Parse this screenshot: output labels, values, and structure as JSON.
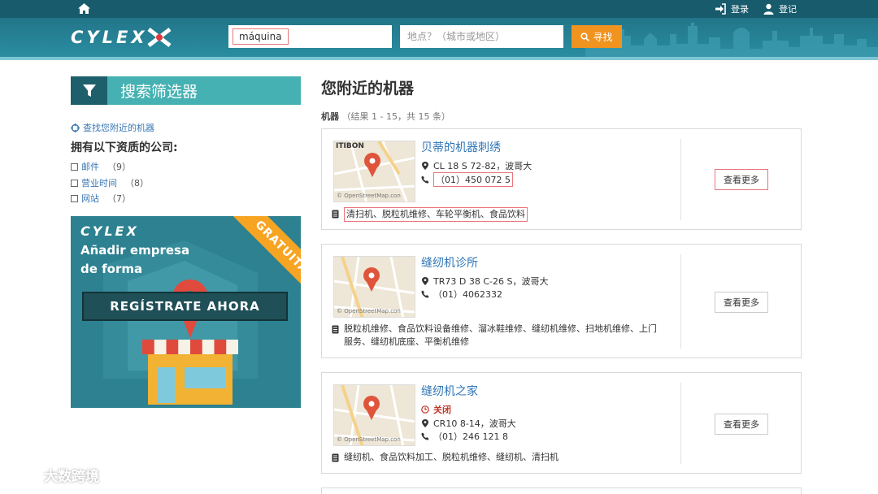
{
  "header": {
    "login_label": "登录",
    "register_label": "登记",
    "search_value": "máquina",
    "location_placeholder": "地点？（城市或地区）",
    "search_button": "寻找",
    "logo_text": "CYLEX"
  },
  "sidebar": {
    "filter_title": "搜索筛选器",
    "near_link": "查找您附近的机器",
    "quals_title": "拥有以下资质的公司:",
    "quals": [
      {
        "label": "邮件",
        "count": "（9）"
      },
      {
        "label": "营业时间",
        "count": "（8）"
      },
      {
        "label": "网站",
        "count": "（7）"
      }
    ],
    "promo": {
      "logo": "CYLEX",
      "line1": "Añadir empresa",
      "line2": "de forma",
      "ribbon": "GRATUITA!",
      "cta": "REGÍSTRATE AHORA"
    }
  },
  "main": {
    "title": "您附近的机器",
    "results_label": "机器",
    "results_detail": "（结果 1 - 15，共 15 条）",
    "listings": [
      {
        "name": "贝蒂的机器刺绣",
        "status": "",
        "address": "CL 18 S 72-82，波哥大",
        "phone": "（01）450 072 5",
        "tags": "清扫机、脱粒机维修、车轮平衡机、食品饮料",
        "map_label": "ITIBON",
        "more": "查看更多"
      },
      {
        "name": "缝纫机诊所",
        "status": "",
        "address": "TR73 D 38 C-26 S，波哥大",
        "phone": "（01）4062332",
        "tags_line1": "脱粒机维修、食品饮料设备维修、溜冰鞋维修、缝纫机维修、扫地机维修、上门",
        "tags_line2": "服务、缝纫机底座、平衡机维修",
        "more": "查看更多"
      },
      {
        "name": "缝纫机之家",
        "status": "关闭",
        "address": "CR10 8-14，波哥大",
        "phone": "（01）246 121 8",
        "tags": "缝纫机、食品饮料加工、脱粒机维修、缝纫机、清扫机",
        "more": "查看更多"
      }
    ],
    "map_credit": "© OpenStreetMap.con"
  },
  "watermark": "大数跨境",
  "colors": {
    "topbar": "#175b6d",
    "accent_orange": "#f0931f",
    "filter_teal": "#45b1b2",
    "link_blue": "#2e75b6"
  }
}
